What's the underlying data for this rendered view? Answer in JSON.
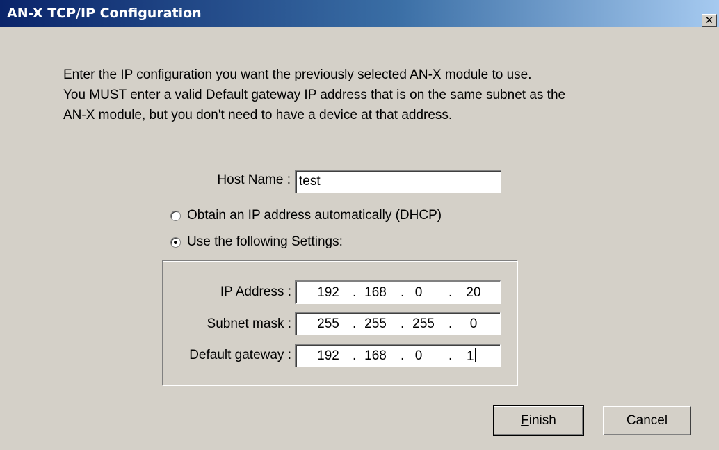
{
  "window": {
    "title": "AN-X TCP/IP Configuration",
    "close_glyph": "✕"
  },
  "instructions": [
    "Enter the IP configuration you want the previously selected AN-X module to use.",
    "You MUST enter a valid Default gateway IP address that is on the same subnet as the",
    "AN-X module, but you don't need to have a device at that address."
  ],
  "host": {
    "label": "Host Name :",
    "value": "test"
  },
  "radios": {
    "dhcp_label": "Obtain an IP address automatically (DHCP)",
    "static_label": "Use the following Settings:",
    "selected": "static"
  },
  "settings": {
    "ip_label": "IP Address :",
    "ip": [
      "192",
      "168",
      "0",
      "20"
    ],
    "subnet_label": "Subnet mask :",
    "subnet": [
      "255",
      "255",
      "255",
      "0"
    ],
    "gateway_label": "Default gateway :",
    "gateway": [
      "192",
      "168",
      "0",
      "1"
    ]
  },
  "buttons": {
    "finish_mnemonic": "F",
    "finish_rest": "inish",
    "cancel": "Cancel"
  },
  "colors": {
    "dialog_bg": "#d4d0c8",
    "title_start": "#0a246a",
    "title_end": "#a6caf0"
  }
}
